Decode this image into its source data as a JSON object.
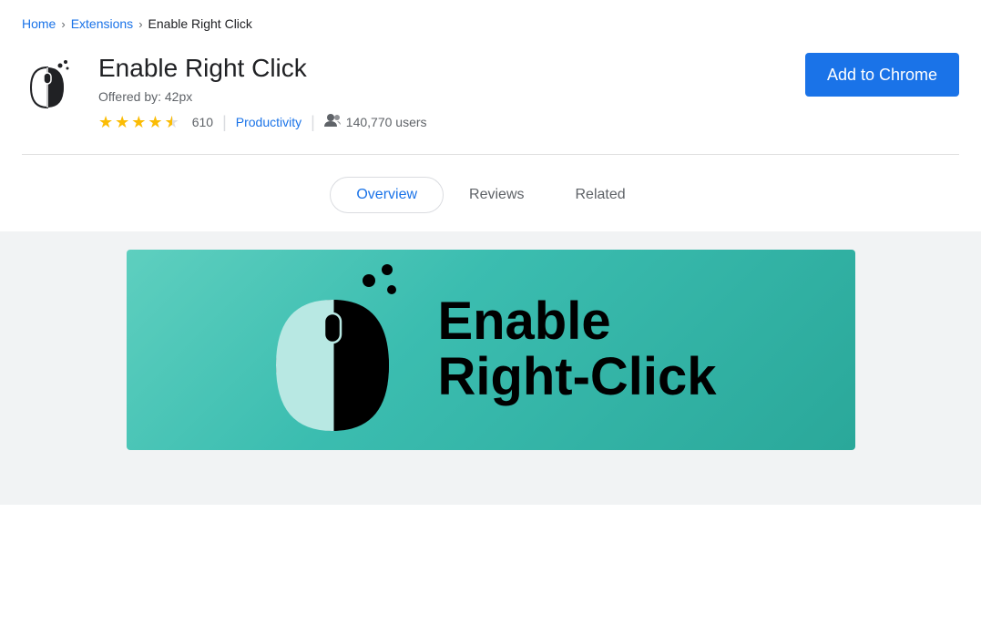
{
  "breadcrumb": {
    "home": "Home",
    "extensions": "Extensions",
    "current": "Enable Right Click"
  },
  "extension": {
    "title": "Enable Right Click",
    "offered_by_label": "Offered by: 42px",
    "rating": "4.5",
    "rating_count": "610",
    "category": "Productivity",
    "users": "140,770 users",
    "add_button_label": "Add to Chrome"
  },
  "tabs": [
    {
      "id": "overview",
      "label": "Overview",
      "active": true
    },
    {
      "id": "reviews",
      "label": "Reviews",
      "active": false
    },
    {
      "id": "related",
      "label": "Related",
      "active": false
    }
  ],
  "banner": {
    "title_line1": "Enable",
    "title_line2": "Right-Click"
  },
  "colors": {
    "accent": "#1a73e8",
    "star": "#fbbc04",
    "banner_bg": "#5ecfbf"
  }
}
